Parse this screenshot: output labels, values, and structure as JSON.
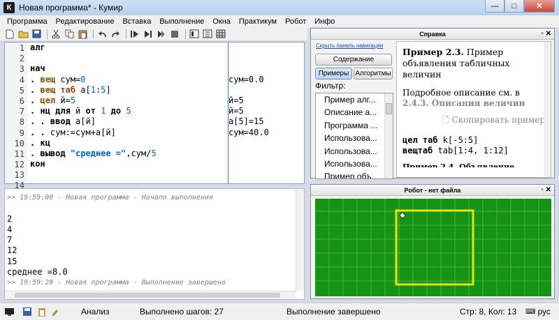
{
  "window": {
    "title": "Новая программа* - Кумир",
    "app_icon": "К",
    "min": "—",
    "max": "□",
    "close": "✕"
  },
  "menu": [
    "Программа",
    "Редактирование",
    "Вставка",
    "Выполнение",
    "Окна",
    "Практикум",
    "Робот",
    "Инфо"
  ],
  "toolbar": [
    "new-file-icon",
    "open-file-icon",
    "save-icon",
    "cut-icon",
    "copy-icon",
    "paste-icon",
    "undo-icon",
    "redo-icon",
    "run-icon",
    "run-step-icon",
    "step-into-icon",
    "stop-icon",
    "console-icon",
    "robot-icon",
    "grid-icon"
  ],
  "editor": {
    "line_numbers": [
      "1",
      "2",
      "3",
      "4",
      "5",
      "6",
      "7",
      "8",
      "9",
      "10",
      "11",
      "12",
      "13",
      "14"
    ],
    "margin_values": [
      "",
      "",
      "",
      "сум=0.0",
      "",
      "й=5",
      "й=5",
      "а[5]=15",
      "сум=40.0",
      "",
      "",
      "",
      "",
      ""
    ]
  },
  "console": {
    "lines": [
      ">> 19:59:08 - Новая программа - Начало выполнения",
      "",
      "2",
      "4",
      "7",
      "12",
      "15",
      "среднее =8.0",
      ">> 19:59:28 - Новая программа - Выполнение завершено"
    ]
  },
  "help": {
    "title": "Справка",
    "hide_link": "Скрыть панель навигации",
    "btn_contents": "Содержание",
    "btn_examples": "Примеры",
    "btn_algorithms": "Алгоритмы",
    "filter_label": "Фильтр:",
    "list": [
      "Пример алг...",
      "Описание а...",
      "Программа ...",
      "Использова...",
      "Использова...",
      "Использова...",
      "Пример объ..."
    ],
    "doc": {
      "heading_bold": "Пример 2.3.",
      "heading_rest": " Пример объявления табличных величин",
      "para": "Подробное описание см. в ",
      "para_ref": "2.4.3. Описания величин",
      "copy_link": "Скопировать пример",
      "code_line1": "цел таб k[-5:5]",
      "code_line2": "вещтаб tab[1:4, 1:12]",
      "cut_line": "Пример 2.4. Объявление"
    }
  },
  "robot": {
    "title": "Робот - нет файла",
    "field_color": "#149314",
    "wall_color": "#e8e600"
  },
  "status": {
    "mode": "Анализ",
    "steps": "Выполнено шагов: 27",
    "state": "Выполнение завершено",
    "pos": "Стр: 8, Кол: 13",
    "lang": "рус"
  }
}
